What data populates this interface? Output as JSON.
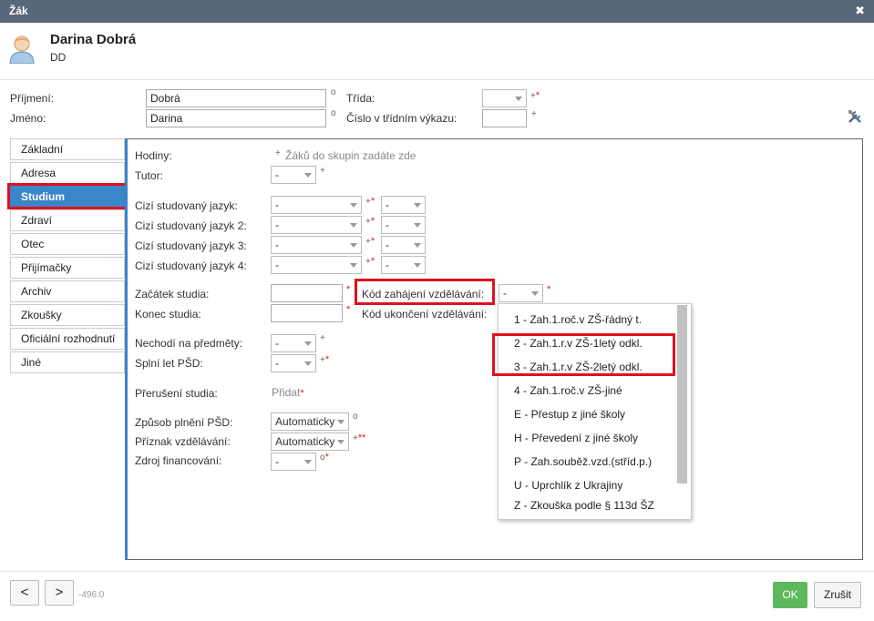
{
  "window": {
    "title": "Žák",
    "close_glyph": "✖"
  },
  "student": {
    "name": "Darina Dobrá",
    "initials": "DD",
    "avatar_icon": "user-avatar-icon"
  },
  "top_form": {
    "surname_label": "Příjmení:",
    "surname_value": "Dobrá",
    "firstname_label": "Jméno:",
    "firstname_value": "Darina",
    "class_label": "Třída:",
    "class_value": "",
    "register_no_label": "Číslo v třídním výkazu:",
    "register_no_value": "",
    "opt_mark": "o",
    "req_mark": "*",
    "plus_mark": "+"
  },
  "tools_icon": "tools-icon",
  "tabs": [
    {
      "label": "Základní"
    },
    {
      "label": "Adresa"
    },
    {
      "label": "Studium",
      "active": true
    },
    {
      "label": "Zdraví"
    },
    {
      "label": "Otec"
    },
    {
      "label": "Přijímačky"
    },
    {
      "label": "Archiv"
    },
    {
      "label": "Zkoušky"
    },
    {
      "label": "Oficiální rozhodnutí"
    },
    {
      "label": "Jiné"
    }
  ],
  "study": {
    "hours_label": "Hodiny:",
    "hours_hint": "Žáků do skupin zadáte zde",
    "tutor_label": "Tutor:",
    "tutor_value": "-",
    "lang1_label": "Cizí studovaný jazyk:",
    "lang2_label": "Cizí studovaný jazyk 2:",
    "lang3_label": "Cizí studovaný jazyk 3:",
    "lang4_label": "Cizí studovaný jazyk 4:",
    "lang_value": "-",
    "lang_level_value": "-",
    "start_label": "Začátek studia:",
    "start_value": "",
    "end_label": "Konec studia:",
    "end_value": "",
    "start_code_label": "Kód zahájení vzdělávání:",
    "start_code_value": "-",
    "end_code_label": "Kód ukončení vzdělávání:",
    "not_attending_label": "Nechodí na předměty:",
    "not_attending_value": "-",
    "psd_years_label": "Splní let PŠD:",
    "psd_years_value": "-",
    "interruption_label": "Přerušení studia:",
    "interruption_add": "Přidat",
    "psd_mode_label": "Způsob plnění PŠD:",
    "psd_mode_value": "Automaticky",
    "edu_flag_label": "Příznak vzdělávání:",
    "edu_flag_value": "Automaticky",
    "funding_label": "Zdroj financování:",
    "funding_value": "-"
  },
  "start_code_options": [
    "1 - Zah.1.roč.v ZŠ-řádný t.",
    "2 - Zah.1.r.v ZŠ-1letý odkl.",
    "3 - Zah.1.r.v ZŠ-2letý odkl.",
    "4 - Zah.1.roč.v ZŠ-jiné",
    "E - Přestup z jiné školy",
    "H - Převedení z jiné školy",
    "P - Zah.souběž.vzd.(stříd.p.)",
    "U - Uprchlík z Ukrajiny",
    "Z - Zkouška podle § 113d ŠZ"
  ],
  "footer": {
    "prev": "<",
    "next": ">",
    "record_id": "-496:0",
    "ok": "OK",
    "cancel": "Zrušit"
  },
  "colors": {
    "accent": "#3a86c8",
    "highlight": "#e01020",
    "ok": "#5cb85c",
    "titlebar": "#586779"
  }
}
